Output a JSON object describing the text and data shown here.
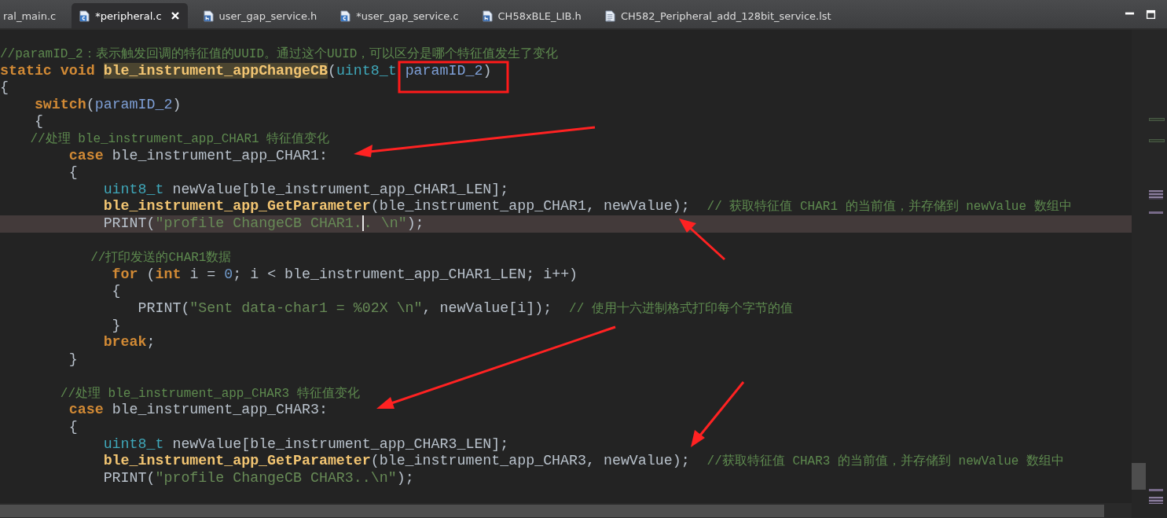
{
  "tabs": [
    {
      "label": "ral_main.c",
      "selected": false
    },
    {
      "label": "*peripheral.c",
      "selected": true,
      "kind": "c",
      "closable": true
    },
    {
      "label": "user_gap_service.h",
      "selected": false,
      "kind": "h"
    },
    {
      "label": "*user_gap_service.c",
      "selected": false,
      "kind": "c"
    },
    {
      "label": "CH58xBLE_LIB.h",
      "selected": false,
      "kind": "h"
    },
    {
      "label": "CH582_Peripheral_add_128bit_service.lst",
      "selected": false,
      "kind": "listing"
    }
  ],
  "lines": [
    {
      "current": false,
      "tokens": [
        {
          "kind": "comment",
          "text": "//paramID_2：表示触发回调的特征值的UUID。通过这个UUID，可以区分是哪个特征值发生了变化"
        }
      ]
    },
    {
      "current": false,
      "tokens": [
        {
          "kind": "keyword",
          "text": "static void "
        },
        {
          "kind": "function-mark",
          "text": "ble_instrument_appChangeCB"
        },
        {
          "kind": "plain",
          "text": "("
        },
        {
          "kind": "type",
          "text": "uint8_t"
        },
        {
          "kind": "param",
          "text": " paramID_2"
        },
        {
          "kind": "plain",
          "text": ")"
        }
      ]
    },
    {
      "current": false,
      "tokens": [
        {
          "kind": "plain",
          "text": "{"
        }
      ]
    },
    {
      "current": false,
      "tokens": [
        {
          "kind": "keyword",
          "text": "    switch"
        },
        {
          "kind": "plain",
          "text": "("
        },
        {
          "kind": "param",
          "text": "paramID_2"
        },
        {
          "kind": "plain",
          "text": ")"
        }
      ]
    },
    {
      "current": false,
      "tokens": [
        {
          "kind": "plain",
          "text": "    {"
        }
      ]
    },
    {
      "current": false,
      "tokens": [
        {
          "kind": "comment",
          "text": "    //处理 ble_instrument_app_CHAR1 特征值变化"
        }
      ]
    },
    {
      "current": false,
      "tokens": [
        {
          "kind": "keyword",
          "text": "        case"
        },
        {
          "kind": "plain",
          "text": " ble_instrument_app_CHAR1:"
        }
      ]
    },
    {
      "current": false,
      "tokens": [
        {
          "kind": "plain",
          "text": "        {"
        }
      ]
    },
    {
      "current": false,
      "tokens": [
        {
          "kind": "type",
          "text": "            uint8_t"
        },
        {
          "kind": "plain",
          "text": " newValue[ble_instrument_app_CHAR1_LEN];"
        }
      ]
    },
    {
      "current": false,
      "tokens": [
        {
          "kind": "function",
          "text": "            ble_instrument_app_GetParameter"
        },
        {
          "kind": "plain",
          "text": "(ble_instrument_app_CHAR1, newValue);  "
        },
        {
          "kind": "comment",
          "text": "// 获取特征值 CHAR1 的当前值，并存储到 newValue 数组中"
        }
      ]
    },
    {
      "current": true,
      "tokens": [
        {
          "kind": "plain",
          "text": "            PRINT("
        },
        {
          "kind": "string",
          "text": "\"profile ChangeCB CHAR1.",
          "caret": true
        },
        {
          "kind": "string",
          "text": ". \\n\""
        },
        {
          "kind": "plain",
          "text": ");"
        }
      ]
    },
    {
      "current": false
    },
    {
      "current": false,
      "tokens": [
        {
          "kind": "comment",
          "text": "            //打印发送的CHAR1数据"
        }
      ]
    },
    {
      "current": false,
      "tokens": [
        {
          "kind": "keyword",
          "text": "             for"
        },
        {
          "kind": "plain",
          "text": " ("
        },
        {
          "kind": "keyword",
          "text": "int"
        },
        {
          "kind": "plain",
          "text": " i = "
        },
        {
          "kind": "number",
          "text": "0"
        },
        {
          "kind": "plain",
          "text": "; i < ble_instrument_app_CHAR1_LEN; i++)"
        }
      ]
    },
    {
      "current": false,
      "tokens": [
        {
          "kind": "plain",
          "text": "             {"
        }
      ]
    },
    {
      "current": false,
      "tokens": [
        {
          "kind": "plain",
          "text": "                PRINT("
        },
        {
          "kind": "string",
          "text": "\"Sent data-char1 = %02X \\n\""
        },
        {
          "kind": "plain",
          "text": ", newValue[i]);  "
        },
        {
          "kind": "comment",
          "text": "// 使用十六进制格式打印每个字节的值"
        }
      ]
    },
    {
      "current": false,
      "tokens": [
        {
          "kind": "plain",
          "text": "             }"
        }
      ]
    },
    {
      "current": false,
      "tokens": [
        {
          "kind": "keyword",
          "text": "            break"
        },
        {
          "kind": "plain",
          "text": ";"
        }
      ]
    },
    {
      "current": false,
      "tokens": [
        {
          "kind": "plain",
          "text": "        }"
        }
      ]
    },
    {
      "current": false
    },
    {
      "current": false,
      "tokens": [
        {
          "kind": "comment",
          "text": "        //处理 ble_instrument_app_CHAR3 特征值变化"
        }
      ]
    },
    {
      "current": false,
      "tokens": [
        {
          "kind": "keyword",
          "text": "        case"
        },
        {
          "kind": "plain",
          "text": " ble_instrument_app_CHAR3:"
        }
      ]
    },
    {
      "current": false,
      "tokens": [
        {
          "kind": "plain",
          "text": "        {"
        }
      ]
    },
    {
      "current": false,
      "tokens": [
        {
          "kind": "type",
          "text": "            uint8_t"
        },
        {
          "kind": "plain",
          "text": " newValue[ble_instrument_app_CHAR3_LEN];"
        }
      ]
    },
    {
      "current": false,
      "tokens": [
        {
          "kind": "function",
          "text": "            ble_instrument_app_GetParameter"
        },
        {
          "kind": "plain",
          "text": "(ble_instrument_app_CHAR3, newValue);  "
        },
        {
          "kind": "comment",
          "text": "//获取特征值 CHAR3 的当前值，并存储到 newValue 数组中"
        }
      ]
    },
    {
      "current": false,
      "tokens": [
        {
          "kind": "plain",
          "text": "            PRINT("
        },
        {
          "kind": "string",
          "text": "\"profile ChangeCB CHAR3..\\n\""
        },
        {
          "kind": "plain",
          "text": ");"
        }
      ]
    }
  ]
}
